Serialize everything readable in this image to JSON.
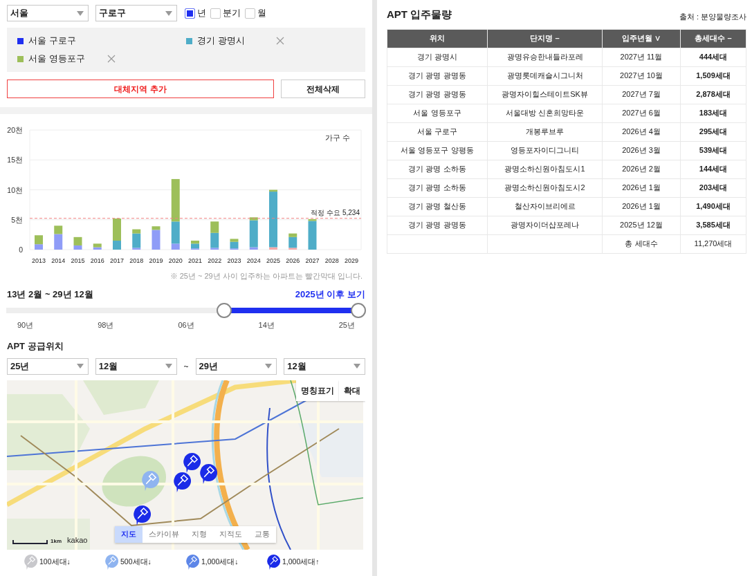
{
  "filters": {
    "region": "서울",
    "district": "구로구",
    "periods": [
      {
        "label": "년",
        "checked": true
      },
      {
        "label": "분기",
        "checked": false
      },
      {
        "label": "월",
        "checked": false
      }
    ]
  },
  "regions": [
    {
      "label": "서울 구로구",
      "color": "#1f2ff0",
      "removable": false
    },
    {
      "label": "경기 광명시",
      "color": "#4fadc8",
      "removable": true
    },
    {
      "label": "서울 영등포구",
      "color": "#9dbf5a",
      "removable": true
    }
  ],
  "buttons": {
    "add": "대체지역 추가",
    "clear": "전체삭제"
  },
  "chart": {
    "chart_data": {
      "type": "bar",
      "stacked": true,
      "grid": true,
      "ylabel": "가구 수",
      "categories": [
        "2013",
        "2014",
        "2015",
        "2016",
        "2017",
        "2018",
        "2019",
        "2020",
        "2021",
        "2022",
        "2023",
        "2024",
        "2025",
        "2026",
        "2027",
        "2028",
        "2029"
      ],
      "series": [
        {
          "color": "#f7a8a8",
          "values": [
            0,
            0,
            0,
            0,
            0,
            0,
            0,
            0,
            0,
            0,
            0,
            0,
            0.4,
            0.3,
            0,
            0,
            0
          ]
        },
        {
          "color": "#8f9cf7",
          "values": [
            0.9,
            2.6,
            0.7,
            0.4,
            0,
            0.3,
            3.3,
            1,
            0.2,
            0.3,
            0.2,
            0.4,
            0,
            0,
            0,
            0,
            0
          ]
        },
        {
          "color": "#4fadc8",
          "values": [
            0,
            0,
            0,
            0,
            1.5,
            2.4,
            0,
            3.7,
            0.8,
            2.5,
            1.1,
            4.5,
            9.3,
            1.8,
            4.8,
            0,
            0
          ]
        },
        {
          "color": "#9dbf5a",
          "values": [
            1.5,
            1.4,
            1.4,
            0.6,
            3.7,
            0.7,
            0.6,
            7.1,
            0.5,
            1.9,
            0.5,
            0.5,
            0.3,
            0.6,
            0.3,
            0,
            0
          ]
        }
      ],
      "ylim": [
        0,
        20
      ],
      "yticks": [
        {
          "value": 0,
          "label": "0"
        },
        {
          "value": 5,
          "label": "5천"
        },
        {
          "value": 10,
          "label": "10천"
        },
        {
          "value": 15,
          "label": "15천"
        },
        {
          "value": 20,
          "label": "20천"
        }
      ],
      "ref_lines": [
        {
          "axis": "y",
          "value": 5.234,
          "label": "적정 수요 5,234"
        }
      ]
    },
    "note": "※ 25년 ~ 29년 사이 입주하는 아파트는 빨간막대 입니다."
  },
  "range": {
    "title": "13년 2월 ~ 29년 12월",
    "link": "2025년 이후 보기",
    "thumbs": [
      {
        "level": 0.61
      },
      {
        "level": 1
      }
    ],
    "ticks": [
      "90년",
      "98년",
      "06년",
      "14년",
      "25년"
    ]
  },
  "supply": {
    "title": "APT 공급위치",
    "selects": [
      "25년",
      "12월",
      "29년",
      "12월"
    ],
    "separator": "~",
    "map": {
      "buttons": [
        "명칭표기",
        "확대"
      ],
      "map_types": [
        {
          "label": "지도",
          "selected": true
        },
        {
          "label": "스카이뷰",
          "selected": false
        },
        {
          "label": "지형",
          "selected": false
        },
        {
          "label": "지적도",
          "selected": false
        },
        {
          "label": "교통",
          "selected": false
        }
      ],
      "scale": "1km",
      "logo": "kakao",
      "markers": [
        {
          "color": "#1a2be8"
        },
        {
          "color": "#1a2be8"
        },
        {
          "color": "#1a2be8"
        },
        {
          "color": "#8fb4f0"
        },
        {
          "color": "#1a2be8"
        }
      ]
    },
    "legend": [
      {
        "label": "100세대↓",
        "color": "#c8c8cc"
      },
      {
        "label": "500세대↓",
        "color": "#8fb4f0"
      },
      {
        "label": "1,000세대↓",
        "color": "#5d86e8"
      },
      {
        "label": "1,000세대↑",
        "color": "#1a2be8"
      }
    ]
  },
  "table": {
    "title": "APT 입주물량",
    "source": "출처 : 분양물량조사",
    "columns": [
      {
        "label": "위치"
      },
      {
        "label": "단지명",
        "sort": "–"
      },
      {
        "label": "입주년월",
        "sort": "∨"
      },
      {
        "label": "총세대수",
        "sort": "–"
      }
    ],
    "rows": [
      [
        "경기 광명시",
        "광명유승한내들라포레",
        "2027년 11월",
        "444세대"
      ],
      [
        "경기 광명 광명동",
        "광명롯데캐슬시그니처",
        "2027년 10월",
        "1,509세대"
      ],
      [
        "경기 광명 광명동",
        "광명자이힐스테이트SK뷰",
        "2027년 7월",
        "2,878세대"
      ],
      [
        "서울 영등포구",
        "서울대방 신혼희망타운",
        "2027년 6월",
        "183세대"
      ],
      [
        "서울 구로구",
        "개봉루브루",
        "2026년 4월",
        "295세대"
      ],
      [
        "서울 영등포구 양평동",
        "영등포자이디그니티",
        "2026년 3월",
        "539세대"
      ],
      [
        "경기 광명 소하동",
        "광명소하신원아침도시1",
        "2026년 2월",
        "144세대"
      ],
      [
        "경기 광명 소하동",
        "광명소하신원아침도시2",
        "2026년 1월",
        "203세대"
      ],
      [
        "경기 광명 철산동",
        "철산자이브리에르",
        "2026년 1월",
        "1,490세대"
      ],
      [
        "경기 광명 광명동",
        "광명자이더샵포레나",
        "2025년 12월",
        "3,585세대"
      ]
    ],
    "total": {
      "label": "총 세대수",
      "value": "11,270세대"
    }
  }
}
